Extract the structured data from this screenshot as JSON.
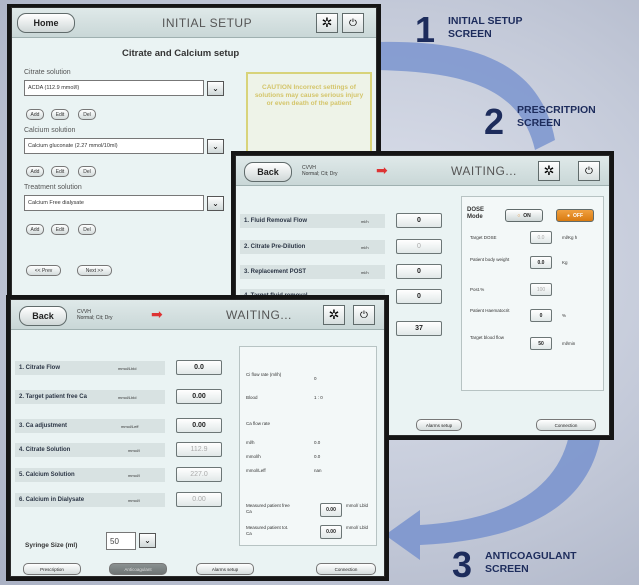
{
  "annotations": {
    "a1": {
      "number": "1",
      "line1": "INITIAL SETUP",
      "line2": "SCREEN"
    },
    "a2": {
      "number": "2",
      "line1": "PRESCRITPION",
      "line2": "SCREEN"
    },
    "a3": {
      "number": "3",
      "line1": "ANTICOAGULANT",
      "line2": "SCREEN"
    }
  },
  "screen1": {
    "home_label": "Home",
    "title": "INITIAL SETUP",
    "heading": "Citrate and Calcium setup",
    "sections": [
      {
        "label": "Citrate solution",
        "value": "ACDA (112.9 mmol/l)"
      },
      {
        "label": "Calcium solution",
        "value": "Calcium gluconate (2.27 mmol/10ml)"
      },
      {
        "label": "Treatment solution",
        "value": "Calcium Free dialysate"
      }
    ],
    "add_label": "Add",
    "edit_label": "Edit",
    "del_label": "Del",
    "caution": "CAUTION Incorrect settings of solutions may cause serious injury or even death of the patient",
    "prev_label": "<< Prev",
    "next_label": "Next >>"
  },
  "screen2": {
    "back_label": "Back",
    "mode_line1": "CVVH",
    "mode_line2": "Normal; Cit; Dry",
    "title": "WAITING...",
    "rows": [
      {
        "label": "1. Fluid Removal Flow",
        "unit": "ml/h",
        "value": "0"
      },
      {
        "label": "2. Citrate Pre-Dilution",
        "unit": "ml/h",
        "value": "0"
      },
      {
        "label": "3. Replacement POST",
        "unit": "ml/h",
        "value": "0"
      },
      {
        "label": "4. Target fluid removal",
        "unit": "ml",
        "value": "0"
      },
      {
        "label": "",
        "unit": "",
        "value": "37"
      }
    ],
    "dose_label": "DOSE Mode",
    "on_label": "ON",
    "off_label": "OFF",
    "fields": [
      {
        "label": "Target DOSE",
        "value": "0.0",
        "unit": "ml/Kg h"
      },
      {
        "label": "Patient body weight",
        "value": "0.0",
        "unit": "Kg"
      },
      {
        "label": "Post.%",
        "value": "100",
        "unit": ""
      },
      {
        "label": "Patient Haematocrit",
        "value": "0",
        "unit": "%"
      },
      {
        "label": "Target blood flow",
        "value": "50",
        "unit": "ml/min"
      }
    ],
    "alarms_label": "Alarms setup",
    "connection_label": "Connection"
  },
  "screen3": {
    "back_label": "Back",
    "mode_line1": "CVVH",
    "mode_line2": "Normal; Cit; Dry",
    "title": "WAITING...",
    "rows": [
      {
        "label": "1. Citrate Flow",
        "unit": "mmol/Lbld",
        "value": "0.0"
      },
      {
        "label": "2. Target patient free Ca",
        "unit": "mmol/Lbld",
        "value": "0.00"
      },
      {
        "label": "3. Ca adjustment",
        "unit": "mmol/Leff",
        "value": "0.00"
      },
      {
        "label": "4. Citrate Solution",
        "unit": "mmol/l",
        "value": "112.9"
      },
      {
        "label": "5. Calcium Solution",
        "unit": "mmol/l",
        "value": "227.0"
      },
      {
        "label": "6. Calcium in Dialysate",
        "unit": "mmol/l",
        "value": "0.00"
      }
    ],
    "info": {
      "ci_flow_label": "Ci flow rate (ml/h)",
      "ci_flow_value": "0",
      "blood_label": "Blood",
      "blood_value": "1 : 0",
      "ca_flow_title": "Ca flow rate",
      "ca_rows": [
        {
          "label": "ml/h",
          "value": "0.0"
        },
        {
          "label": "mmol/h",
          "value": "0.0"
        },
        {
          "label": "mmol/Leff",
          "value": "nan"
        }
      ],
      "measured_free_label": "Measured patient free Ca",
      "measured_free_value": "0.00",
      "measured_free_unit": "mmol/ Lbld",
      "measured_tot_label": "Measured patient tot. Ca",
      "measured_tot_value": "0.00",
      "measured_tot_unit": "mmol/ Lbld"
    },
    "syringe_label": "Syringe Size (ml)",
    "syringe_value": "50",
    "bottom_buttons": [
      "Prescription",
      "Anticoagulant",
      "Alarms setup",
      "Connection"
    ]
  }
}
